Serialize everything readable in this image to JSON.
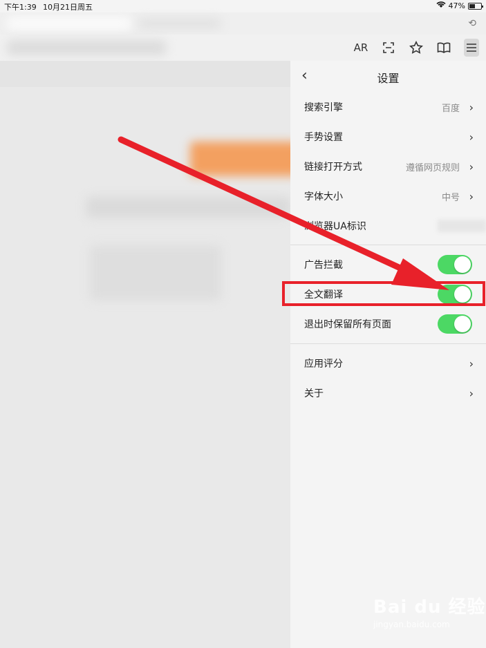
{
  "status_bar": {
    "time": "下午1:39",
    "date": "10月21日周五",
    "battery": "47%"
  },
  "toolbar": {
    "ar_label": "AR",
    "icons": [
      "scan-icon",
      "star-icon",
      "book-icon",
      "menu-icon"
    ]
  },
  "settings": {
    "title": "设置",
    "items": [
      {
        "label": "搜索引擎",
        "value": "百度"
      },
      {
        "label": "手势设置",
        "value": ""
      },
      {
        "label": "链接打开方式",
        "value": "遵循网页规则"
      },
      {
        "label": "字体大小",
        "value": "中号"
      },
      {
        "label": "浏览器UA标识",
        "value": ""
      }
    ],
    "toggles": [
      {
        "label": "广告拦截",
        "on": true
      },
      {
        "label": "全文翻译",
        "on": true
      },
      {
        "label": "退出时保留所有页面",
        "on": true
      }
    ],
    "links": [
      {
        "label": "应用评分"
      },
      {
        "label": "关于"
      }
    ]
  },
  "colors": {
    "toggle_on": "#4cd864",
    "annotation_red": "#e8212a",
    "panel_bg": "#f4f4f4"
  },
  "watermark": {
    "brand": "Bai du 经验",
    "site": "jingyan.baidu.com"
  }
}
